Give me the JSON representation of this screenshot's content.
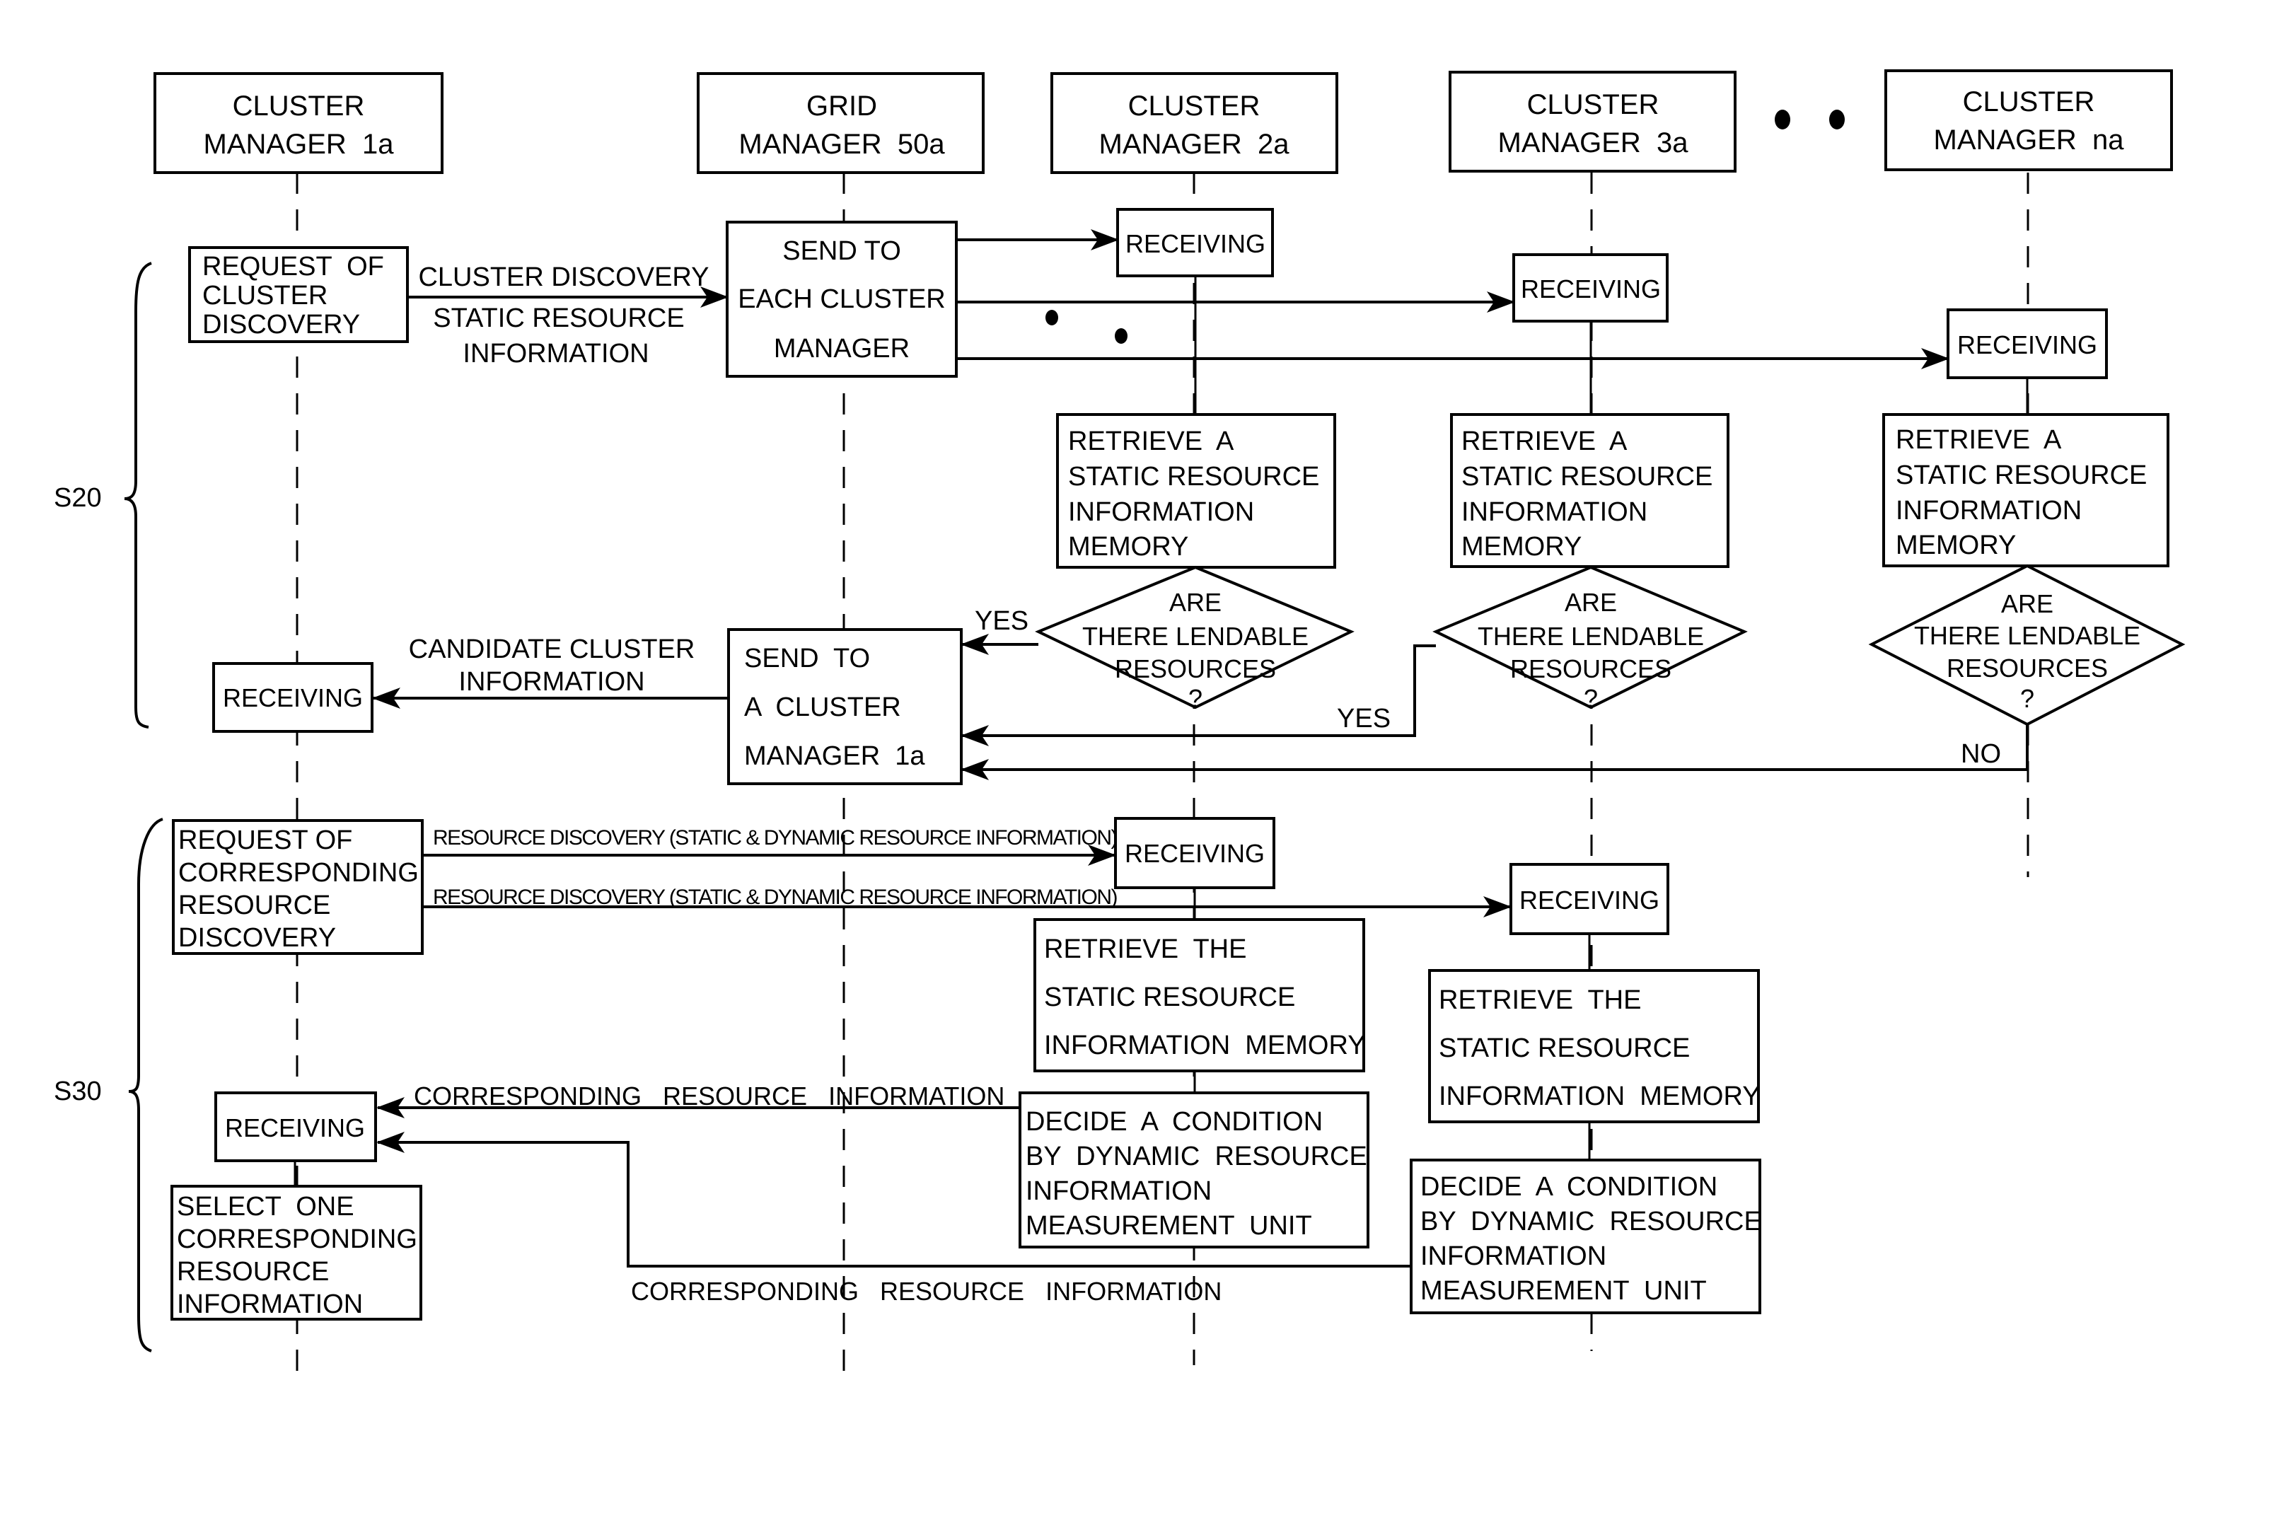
{
  "diagram": {
    "type": "sequence-flowchart",
    "participants": [
      {
        "id": "cm1a",
        "lines": [
          "CLUSTER",
          "MANAGER  1a"
        ]
      },
      {
        "id": "gm50a",
        "lines": [
          "GRID",
          "MANAGER  50a"
        ]
      },
      {
        "id": "cm2a",
        "lines": [
          "CLUSTER",
          "MANAGER  2a"
        ]
      },
      {
        "id": "cm3a",
        "lines": [
          "CLUSTER",
          "MANAGER  3a"
        ]
      },
      {
        "id": "cmna",
        "lines": [
          "CLUSTER",
          "MANAGER  na"
        ]
      }
    ],
    "ellipsis": "• •",
    "phases": [
      {
        "id": "s20",
        "label": "S20"
      },
      {
        "id": "s30",
        "label": "S30"
      }
    ],
    "s20": {
      "request_box": [
        "REQUEST  OF",
        "CLUSTER",
        "DISCOVERY"
      ],
      "request_msg": [
        "CLUSTER DISCOVERY",
        "STATIC RESOURCE",
        "INFORMATION"
      ],
      "send_each_box": [
        "SEND TO",
        "EACH CLUSTER",
        "MANAGER"
      ],
      "receiving": "RECEIVING",
      "retrieve_box": [
        "RETRIEVE  A",
        "STATIC RESOURCE",
        "INFORMATION",
        "MEMORY"
      ],
      "decision": [
        "ARE",
        "THERE LENDABLE",
        "RESOURCES",
        "?"
      ],
      "yes": "YES",
      "no": "NO",
      "send_one_box": [
        "SEND  TO",
        "A  CLUSTER",
        "MANAGER  1a"
      ],
      "candidate_msg": [
        "CANDIDATE CLUSTER",
        "INFORMATION"
      ]
    },
    "s30": {
      "request_box": [
        "REQUEST OF",
        "CORRESPONDING",
        "RESOURCE",
        "DISCOVERY"
      ],
      "resource_msg": "RESOURCE DISCOVERY (STATIC & DYNAMIC RESOURCE INFORMATION)",
      "receiving": "RECEIVING",
      "retrieve_box": [
        "RETRIEVE  THE",
        "STATIC RESOURCE",
        "INFORMATION  MEMORY"
      ],
      "decide_box": [
        "DECIDE  A  CONDITION",
        "BY  DYNAMIC  RESOURCE",
        "INFORMATION",
        "MEASUREMENT  UNIT"
      ],
      "corresponding_msg": "CORRESPONDING   RESOURCE   INFORMATION",
      "select_box": [
        "SELECT  ONE",
        "CORRESPONDING",
        "RESOURCE",
        "INFORMATION"
      ]
    }
  }
}
